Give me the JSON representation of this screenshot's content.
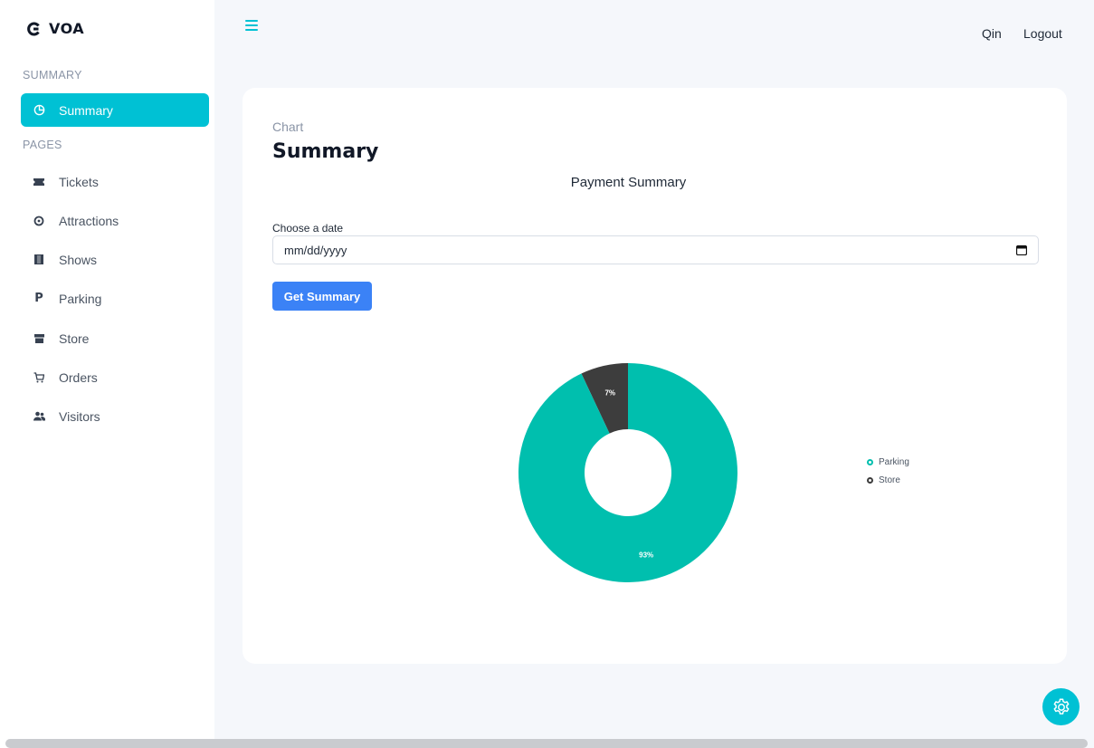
{
  "brand": {
    "name": "VOA"
  },
  "sidebar": {
    "summary_heading": "SUMMARY",
    "pages_heading": "PAGES",
    "active_item": {
      "label": "Summary",
      "icon": "pie-chart-icon"
    },
    "items": [
      {
        "label": "Tickets",
        "icon": "ticket-icon"
      },
      {
        "label": "Attractions",
        "icon": "ferris-wheel-icon"
      },
      {
        "label": "Shows",
        "icon": "film-icon"
      },
      {
        "label": "Parking",
        "icon": "parking-icon"
      },
      {
        "label": "Store",
        "icon": "store-icon"
      },
      {
        "label": "Orders",
        "icon": "cart-icon"
      },
      {
        "label": "Visitors",
        "icon": "users-icon"
      }
    ]
  },
  "topbar": {
    "user": "Qin",
    "logout": "Logout"
  },
  "page": {
    "pretitle": "Chart",
    "title": "Summary",
    "chart_title": "Payment Summary",
    "date_label": "Choose a date",
    "date_placeholder": "mm/dd/yyyy",
    "submit_label": "Get Summary"
  },
  "colors": {
    "accent": "#00c1d4",
    "primary_button": "#3b82f6",
    "parking": "#00bfae",
    "store": "#3d3d3d"
  },
  "chart_data": {
    "type": "pie",
    "title": "Payment Summary",
    "categories": [
      "Parking",
      "Store"
    ],
    "values": [
      93,
      7
    ],
    "labels": [
      "93%",
      "7%"
    ],
    "legend_placement": "right"
  }
}
